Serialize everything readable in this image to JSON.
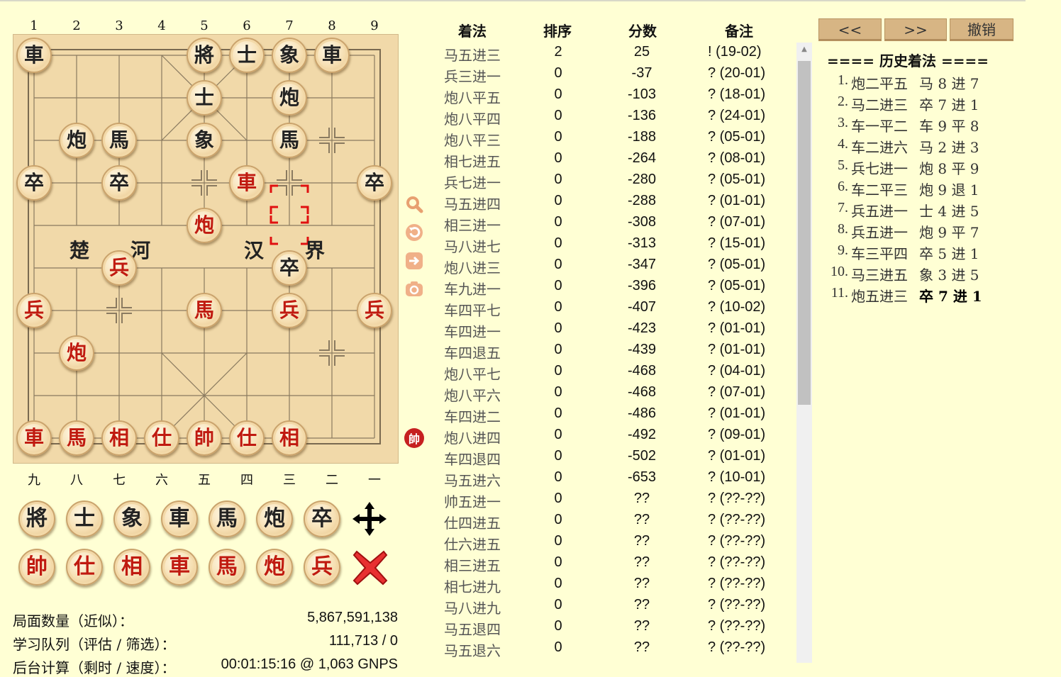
{
  "board": {
    "top_numbers": [
      "1",
      "2",
      "3",
      "4",
      "5",
      "6",
      "7",
      "8",
      "9"
    ],
    "bottom_numbers": [
      "九",
      "八",
      "七",
      "六",
      "五",
      "四",
      "三",
      "二",
      "一"
    ],
    "river": [
      "楚",
      "河",
      "汉",
      "界"
    ],
    "pieces": [
      {
        "c": "车",
        "t": "車",
        "side": "black",
        "file": 0,
        "rank": 0
      },
      {
        "c": "将",
        "t": "將",
        "side": "black",
        "file": 4,
        "rank": 0
      },
      {
        "c": "士",
        "t": "士",
        "side": "black",
        "file": 5,
        "rank": 0
      },
      {
        "c": "象",
        "t": "象",
        "side": "black",
        "file": 6,
        "rank": 0
      },
      {
        "c": "车",
        "t": "車",
        "side": "black",
        "file": 7,
        "rank": 0
      },
      {
        "c": "士",
        "t": "士",
        "side": "black",
        "file": 4,
        "rank": 1
      },
      {
        "c": "炮",
        "t": "炮",
        "side": "black",
        "file": 6,
        "rank": 1
      },
      {
        "c": "炮",
        "t": "炮",
        "side": "black",
        "file": 1,
        "rank": 2
      },
      {
        "c": "马",
        "t": "馬",
        "side": "black",
        "file": 2,
        "rank": 2
      },
      {
        "c": "象",
        "t": "象",
        "side": "black",
        "file": 4,
        "rank": 2
      },
      {
        "c": "马",
        "t": "馬",
        "side": "black",
        "file": 6,
        "rank": 2
      },
      {
        "c": "卒",
        "t": "卒",
        "side": "black",
        "file": 0,
        "rank": 3
      },
      {
        "c": "卒",
        "t": "卒",
        "side": "black",
        "file": 2,
        "rank": 3
      },
      {
        "c": "车",
        "t": "車",
        "side": "red",
        "file": 5,
        "rank": 3
      },
      {
        "c": "卒",
        "t": "卒",
        "side": "black",
        "file": 8,
        "rank": 3
      },
      {
        "c": "炮",
        "t": "炮",
        "side": "red",
        "file": 4,
        "rank": 4
      },
      {
        "c": "兵",
        "t": "兵",
        "side": "red",
        "file": 2,
        "rank": 5
      },
      {
        "c": "卒",
        "t": "卒",
        "side": "black",
        "file": 6,
        "rank": 5
      },
      {
        "c": "兵",
        "t": "兵",
        "side": "red",
        "file": 0,
        "rank": 6
      },
      {
        "c": "马",
        "t": "馬",
        "side": "red",
        "file": 4,
        "rank": 6
      },
      {
        "c": "兵",
        "t": "兵",
        "side": "red",
        "file": 6,
        "rank": 6
      },
      {
        "c": "兵",
        "t": "兵",
        "side": "red",
        "file": 8,
        "rank": 6
      },
      {
        "c": "炮",
        "t": "炮",
        "side": "red",
        "file": 1,
        "rank": 7
      },
      {
        "c": "车",
        "t": "車",
        "side": "red",
        "file": 0,
        "rank": 9
      },
      {
        "c": "马",
        "t": "馬",
        "side": "red",
        "file": 1,
        "rank": 9
      },
      {
        "c": "相",
        "t": "相",
        "side": "red",
        "file": 2,
        "rank": 9
      },
      {
        "c": "仕",
        "t": "仕",
        "side": "red",
        "file": 3,
        "rank": 9
      },
      {
        "c": "帅",
        "t": "帥",
        "side": "red",
        "file": 4,
        "rank": 9
      },
      {
        "c": "仕",
        "t": "仕",
        "side": "red",
        "file": 5,
        "rank": 9
      },
      {
        "c": "相",
        "t": "相",
        "side": "red",
        "file": 6,
        "rank": 9
      }
    ],
    "last_move_highlight": {
      "file": 6,
      "rank": 4
    },
    "turn_indicator": "帥"
  },
  "palette": {
    "black": [
      "將",
      "士",
      "象",
      "車",
      "馬",
      "炮",
      "卒"
    ],
    "red": [
      "帥",
      "仕",
      "相",
      "車",
      "馬",
      "炮",
      "兵"
    ],
    "move_tool": "move-arrows-icon",
    "delete_tool": "delete-x-icon"
  },
  "stats": [
    {
      "label": "局面数量（近似）：",
      "value": "5,867,591,138"
    },
    {
      "label": "学习队列（评估 / 筛选）：",
      "value": "111,713 / 0"
    },
    {
      "label": "后台计算（剩时 / 速度）：",
      "value": "00:01:15:16 @ 1,063 GNPS"
    }
  ],
  "moves_table": {
    "headers": [
      "着法",
      "排序",
      "分数",
      "备注"
    ],
    "rows": [
      {
        "move": "马五进三",
        "rank": "2",
        "score": "25",
        "note": "! (19-02)"
      },
      {
        "move": "兵三进一",
        "rank": "0",
        "score": "-37",
        "note": "? (20-01)"
      },
      {
        "move": "炮八平五",
        "rank": "0",
        "score": "-103",
        "note": "? (18-01)"
      },
      {
        "move": "炮八平四",
        "rank": "0",
        "score": "-136",
        "note": "? (24-01)"
      },
      {
        "move": "炮八平三",
        "rank": "0",
        "score": "-188",
        "note": "? (05-01)"
      },
      {
        "move": "相七进五",
        "rank": "0",
        "score": "-264",
        "note": "? (08-01)"
      },
      {
        "move": "兵七进一",
        "rank": "0",
        "score": "-280",
        "note": "? (05-01)"
      },
      {
        "move": "马五进四",
        "rank": "0",
        "score": "-288",
        "note": "? (01-01)"
      },
      {
        "move": "相三进一",
        "rank": "0",
        "score": "-308",
        "note": "? (07-01)"
      },
      {
        "move": "马八进七",
        "rank": "0",
        "score": "-313",
        "note": "? (15-01)"
      },
      {
        "move": "炮八进三",
        "rank": "0",
        "score": "-347",
        "note": "? (05-01)"
      },
      {
        "move": "车九进一",
        "rank": "0",
        "score": "-396",
        "note": "? (05-01)"
      },
      {
        "move": "车四平七",
        "rank": "0",
        "score": "-407",
        "note": "? (10-02)"
      },
      {
        "move": "车四进一",
        "rank": "0",
        "score": "-423",
        "note": "? (01-01)"
      },
      {
        "move": "车四退五",
        "rank": "0",
        "score": "-439",
        "note": "? (01-01)"
      },
      {
        "move": "炮八平七",
        "rank": "0",
        "score": "-468",
        "note": "? (04-01)"
      },
      {
        "move": "炮八平六",
        "rank": "0",
        "score": "-468",
        "note": "? (07-01)"
      },
      {
        "move": "车四进二",
        "rank": "0",
        "score": "-486",
        "note": "? (01-01)"
      },
      {
        "move": "炮八进四",
        "rank": "0",
        "score": "-492",
        "note": "? (09-01)"
      },
      {
        "move": "车四退四",
        "rank": "0",
        "score": "-502",
        "note": "? (01-01)"
      },
      {
        "move": "马五进六",
        "rank": "0",
        "score": "-653",
        "note": "? (10-01)"
      },
      {
        "move": "帅五进一",
        "rank": "0",
        "score": "??",
        "note": "? (??-??)"
      },
      {
        "move": "仕四进五",
        "rank": "0",
        "score": "??",
        "note": "? (??-??)"
      },
      {
        "move": "仕六进五",
        "rank": "0",
        "score": "??",
        "note": "? (??-??)"
      },
      {
        "move": "相三进五",
        "rank": "0",
        "score": "??",
        "note": "? (??-??)"
      },
      {
        "move": "相七进九",
        "rank": "0",
        "score": "??",
        "note": "? (??-??)"
      },
      {
        "move": "马八进九",
        "rank": "0",
        "score": "??",
        "note": "? (??-??)"
      },
      {
        "move": "马五退四",
        "rank": "0",
        "score": "??",
        "note": "? (??-??)"
      },
      {
        "move": "马五退六",
        "rank": "0",
        "score": "??",
        "note": "? (??-??)"
      }
    ]
  },
  "nav_buttons": {
    "prev": "<<",
    "next": ">>",
    "undo": "撤销"
  },
  "history": {
    "title": "==== 历史着法 ====",
    "moves": [
      {
        "num": "1.",
        "red": "炮二平五",
        "black": "马 8 进 7"
      },
      {
        "num": "2.",
        "red": "马二进三",
        "black": "卒 7 进 1"
      },
      {
        "num": "3.",
        "red": "车一平二",
        "black": "车 9 平 8"
      },
      {
        "num": "4.",
        "red": "车二进六",
        "black": "马 2 进 3"
      },
      {
        "num": "5.",
        "red": "兵七进一",
        "black": "炮 8 平 9"
      },
      {
        "num": "6.",
        "red": "车二平三",
        "black": "炮 9 退 1"
      },
      {
        "num": "7.",
        "red": "兵五进一",
        "black": "士 4 进 5"
      },
      {
        "num": "8.",
        "red": "兵五进一",
        "black": "炮 9 平 7"
      },
      {
        "num": "9.",
        "red": "车三平四",
        "black": "卒 5 进 1"
      },
      {
        "num": "10.",
        "red": "马三进五",
        "black": "象 3 进 5"
      },
      {
        "num": "11.",
        "red": "炮五进三",
        "black": "卒 7 进 1"
      }
    ]
  },
  "tool_icons": [
    "search-icon",
    "rotate-icon",
    "arrow-right-icon",
    "camera-icon"
  ],
  "colors": {
    "background": "#ffffd4",
    "board": "#f1d9a9",
    "red": "#c01a10",
    "button": "#d7b584",
    "highlight": "#e01010"
  }
}
